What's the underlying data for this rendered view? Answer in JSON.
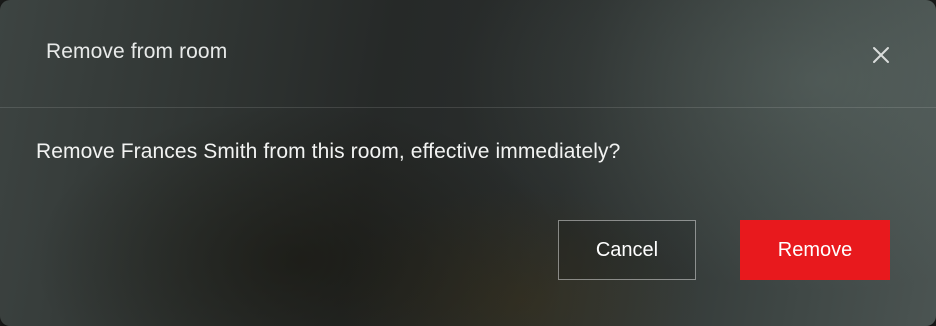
{
  "dialog": {
    "title": "Remove from room",
    "close_icon": "close-icon",
    "message": "Remove Frances Smith from this room, effective immediately?",
    "cancel_label": "Cancel",
    "remove_label": "Remove",
    "colors": {
      "remove_button": "#e8191d",
      "text": "#f2f3f2"
    }
  }
}
